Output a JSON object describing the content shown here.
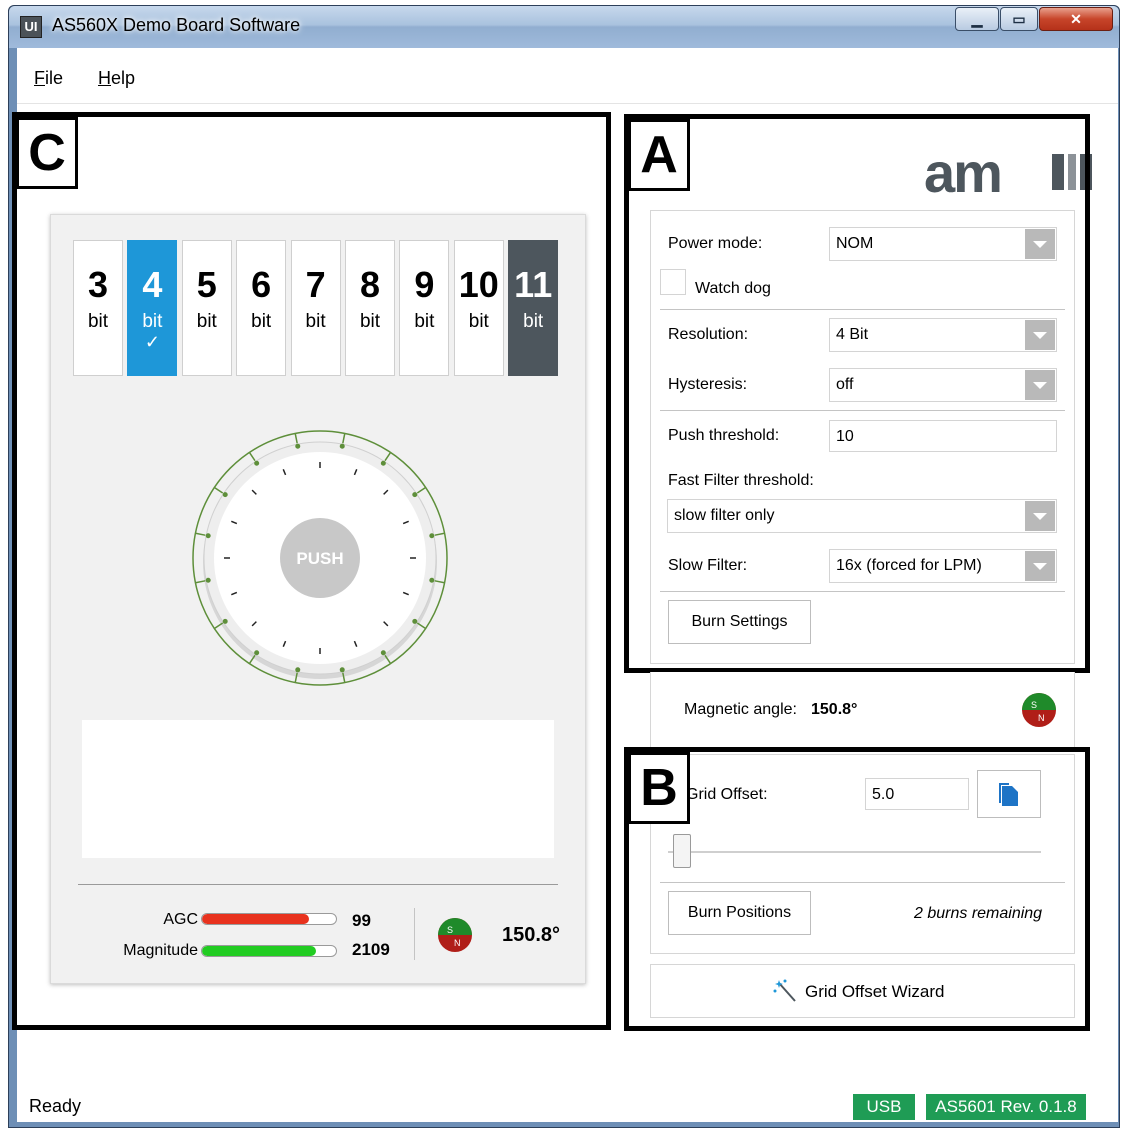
{
  "window": {
    "title": "AS560X Demo Board Software",
    "icon_label": "UI"
  },
  "menu": {
    "file": "File",
    "file_rest": "ile",
    "file_key": "F",
    "help_key": "H",
    "help_rest": "elp"
  },
  "panel_labels": {
    "a": "A",
    "b": "B",
    "c": "C"
  },
  "resolution_selector": {
    "bits": [
      {
        "num": "3",
        "label": "bit"
      },
      {
        "num": "4",
        "label": "bit"
      },
      {
        "num": "5",
        "label": "bit"
      },
      {
        "num": "6",
        "label": "bit"
      },
      {
        "num": "7",
        "label": "bit"
      },
      {
        "num": "8",
        "label": "bit"
      },
      {
        "num": "9",
        "label": "bit"
      },
      {
        "num": "10",
        "label": "bit"
      },
      {
        "num": "11",
        "label": "bit"
      }
    ],
    "selected": "4",
    "check": "✓"
  },
  "dial": {
    "push_label": "PUSH"
  },
  "readout": {
    "agc_label": "AGC",
    "agc_value": "99",
    "agc_fill": 0.8,
    "magnitude_label": "Magnitude",
    "magnitude_value": "2109",
    "magnitude_fill": 0.85,
    "angle": "150.8°"
  },
  "settings": {
    "brand": "am",
    "power_mode_label": "Power mode:",
    "power_mode_value": "NOM",
    "watchdog_label": "Watch dog",
    "resolution_label": "Resolution:",
    "resolution_value": "4 Bit",
    "hysteresis_label": "Hysteresis:",
    "hysteresis_value": "off",
    "push_threshold_label": "Push threshold:",
    "push_threshold_value": "10",
    "fast_filter_label": "Fast Filter threshold:",
    "fast_filter_value": "slow filter only",
    "slow_filter_label": "Slow Filter:",
    "slow_filter_value": "16x (forced for LPM)",
    "burn_settings": "Burn Settings"
  },
  "magnetic": {
    "label": "Magnetic angle:",
    "value": "150.8°"
  },
  "grid": {
    "offset_label": "Grid Offset:",
    "offset_value": "5.0",
    "slider_level": 0.0,
    "burn_positions": "Burn Positions",
    "burns_remaining": "2 burns remaining",
    "wizard": "Grid Offset Wizard"
  },
  "status": {
    "text": "Ready",
    "connection": "USB",
    "device": "AS5601 Rev. 0.1.8"
  },
  "colors": {
    "accent": "#1e97d8",
    "dark": "#4d565d",
    "status_green": "#1f9c55",
    "agc_bar": "#e8321e",
    "magnitude_bar": "#22cc22"
  }
}
